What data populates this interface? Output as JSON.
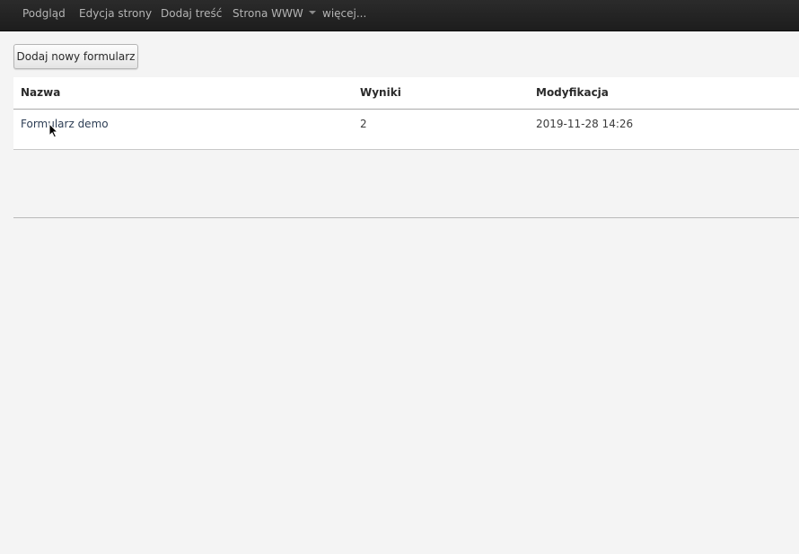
{
  "navbar": {
    "items": [
      {
        "label": "Podgląd"
      },
      {
        "label": "Edycja strony"
      },
      {
        "label": "Dodaj treść"
      },
      {
        "label": "Strona WWW"
      },
      {
        "label": "więcej..."
      }
    ]
  },
  "toolbar": {
    "add_form_label": "Dodaj nowy formularz"
  },
  "forms_table": {
    "columns": [
      "Nazwa",
      "Wyniki",
      "Modyfikacja"
    ],
    "rows": [
      {
        "name": "Formularz demo",
        "results": "2",
        "modified": "2019-11-28 14:26"
      }
    ]
  }
}
